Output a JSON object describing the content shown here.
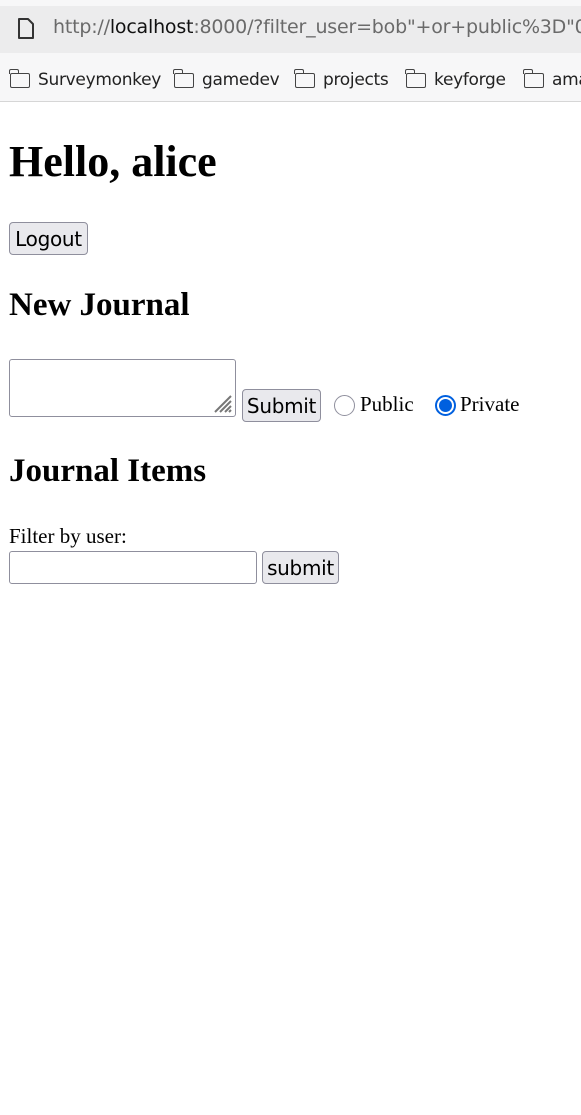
{
  "browser": {
    "url_prefix": "http://",
    "url_host": "localhost",
    "url_rest": ":8000/?filter_user=bob\"+or+public%3D\"0",
    "bookmarks": [
      "Surveymonkey",
      "gamedev",
      "projects",
      "keyforge",
      "ama"
    ]
  },
  "page": {
    "greeting": "Hello, alice",
    "logout_label": "Logout",
    "new_journal_heading": "New Journal",
    "journal_text": "",
    "submit_label": "Submit",
    "visibility_options": [
      {
        "label": "Public",
        "checked": false
      },
      {
        "label": "Private",
        "checked": true
      }
    ],
    "journal_items_heading": "Journal Items",
    "filter_label": "Filter by user:",
    "filter_value": "",
    "filter_submit_label": "submit"
  }
}
